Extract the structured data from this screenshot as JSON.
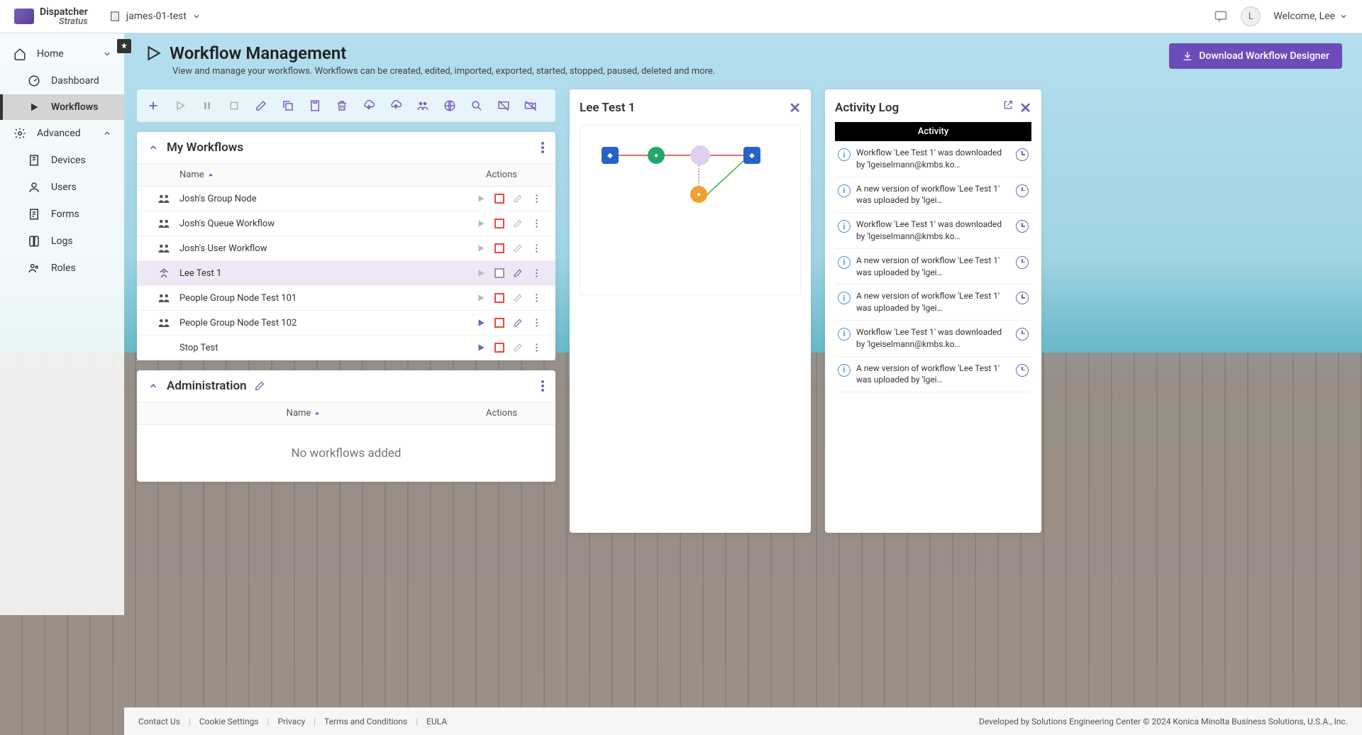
{
  "brand": {
    "line1": "Dispatcher",
    "line2": "Stratus"
  },
  "tenant": "james-01-test",
  "user": {
    "initial": "L",
    "welcome": "Welcome, Lee"
  },
  "sidebar": {
    "home": "Home",
    "dashboard": "Dashboard",
    "workflows": "Workflows",
    "advanced": "Advanced",
    "devices": "Devices",
    "users": "Users",
    "forms": "Forms",
    "logs": "Logs",
    "roles": "Roles"
  },
  "page": {
    "title": "Workflow Management",
    "subtitle": "View and manage your workflows. Workflows can be created, edited, imported, exported, started, stopped, paused, deleted and more.",
    "download_btn": "Download Workflow Designer"
  },
  "groups": {
    "my": {
      "title": "My Workflows",
      "col_name": "Name",
      "col_actions": "Actions",
      "rows": [
        {
          "name": "Josh's Group Node",
          "multi": true,
          "running": false,
          "stopRed": true
        },
        {
          "name": "Josh's Queue Workflow",
          "multi": true,
          "running": false,
          "stopRed": true
        },
        {
          "name": "Josh's User Workflow",
          "multi": true,
          "running": false,
          "stopRed": true
        },
        {
          "name": "Lee Test 1",
          "multi": false,
          "running": false,
          "stopRed": false,
          "selected": true
        },
        {
          "name": "People Group Node Test 101",
          "multi": true,
          "running": false,
          "stopRed": true
        },
        {
          "name": "People Group Node Test 102",
          "multi": true,
          "running": true,
          "stopRed": true
        },
        {
          "name": "Stop Test",
          "multi": false,
          "running": true,
          "stopRed": true,
          "noicon": true
        }
      ]
    },
    "admin": {
      "title": "Administration",
      "col_name": "Name",
      "col_actions": "Actions",
      "empty": "No workflows added"
    }
  },
  "preview": {
    "title": "Lee Test 1"
  },
  "activity": {
    "title": "Activity Log",
    "tab": "Activity",
    "items": [
      "Workflow 'Lee Test 1' was downloaded by 'lgeiselmann@kmbs.ko…",
      "A new version of workflow 'Lee Test 1' was uploaded by 'lgei…",
      "Workflow 'Lee Test 1' was downloaded by 'lgeiselmann@kmbs.ko…",
      "A new version of workflow 'Lee Test 1' was uploaded by 'lgei…",
      "A new version of workflow 'Lee Test 1' was uploaded by 'lgei…",
      "Workflow 'Lee Test 1' was downloaded by 'lgeiselmann@kmbs.ko…",
      "A new version of workflow 'Lee Test 1' was uploaded by 'lgei…"
    ]
  },
  "footer": {
    "contact": "Contact Us",
    "cookie": "Cookie Settings",
    "privacy": "Privacy",
    "terms": "Terms and Conditions",
    "eula": "EULA",
    "copy": "Developed by Solutions Engineering Center © 2024 Konica Minolta Business Solutions, U.S.A., Inc."
  }
}
